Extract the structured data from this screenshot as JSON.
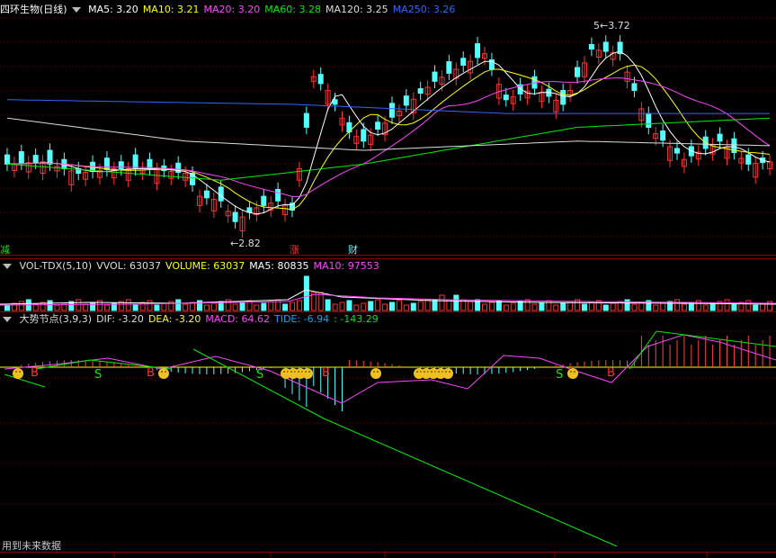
{
  "main_panel": {
    "title": "四环生物(日线)",
    "ma_items": [
      {
        "label": "MA5: 3.20",
        "color": "#ffffff"
      },
      {
        "label": "MA10: 3.21",
        "color": "#ffff00"
      },
      {
        "label": "MA20: 3.20",
        "color": "#ff44ff"
      },
      {
        "label": "MA60: 3.28",
        "color": "#00ee00"
      },
      {
        "label": "MA120: 3.25",
        "color": "#dddddd"
      },
      {
        "label": "MA250: 3.26",
        "color": "#3366ff"
      }
    ],
    "high_label": "3.72",
    "low_label": "2.82",
    "markers": {
      "jian": "减",
      "zhang": "涨",
      "cai": "财"
    }
  },
  "volume_panel": {
    "items": [
      {
        "label": "VOL-TDX(5,10)",
        "color": "#dddddd"
      },
      {
        "label": "VVOL: 63037",
        "color": "#dddddd"
      },
      {
        "label": "VOLUME: 63037",
        "color": "#ffff00"
      },
      {
        "label": "MA5: 80835",
        "color": "#ffffff"
      },
      {
        "label": "MA10: 97553",
        "color": "#ff44ff"
      }
    ]
  },
  "indicator_panel": {
    "items": [
      {
        "label": "大势节点(3,9,3)",
        "color": "#dddddd"
      },
      {
        "label": "DIF: -3.20",
        "color": "#dddddd"
      },
      {
        "label": "DEA: -3.20",
        "color": "#ffff00"
      },
      {
        "label": "MACD: 64.62",
        "color": "#ff44ff"
      },
      {
        "label": "TIDE: -6.94",
        "color": "#00aaff"
      },
      {
        "label": ": -143.29",
        "color": "#00ee00"
      }
    ],
    "signal_S": "S",
    "signal_B": "B"
  },
  "footer": {
    "text": "用到未来数据"
  }
}
